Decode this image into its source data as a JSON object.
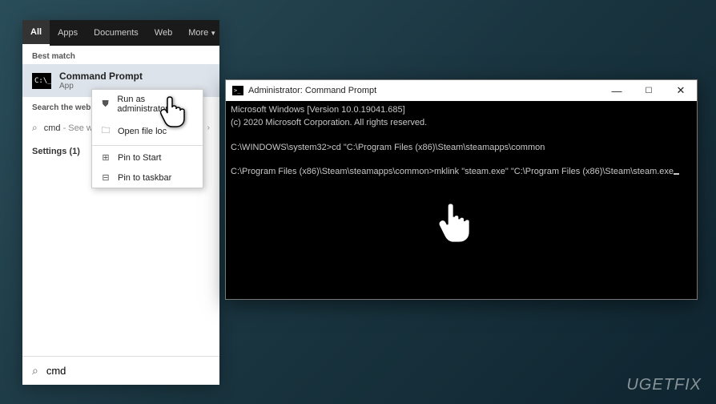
{
  "search_panel": {
    "tabs": [
      {
        "label": "All",
        "active": true
      },
      {
        "label": "Apps",
        "active": false
      },
      {
        "label": "Documents",
        "active": false
      },
      {
        "label": "Web",
        "active": false
      },
      {
        "label": "More",
        "active": false
      }
    ],
    "best_match_label": "Best match",
    "best_match": {
      "title": "Command Prompt",
      "subtitle": "App",
      "icon_text": "C:\\_"
    },
    "search_web_label": "Search the web",
    "web_item": {
      "query": "cmd",
      "suffix": " - See we"
    },
    "settings_label": "Settings (1)",
    "search_input_value": "cmd"
  },
  "context_menu": {
    "items": [
      {
        "icon": "admin-shield",
        "glyph": "⛊",
        "label": "Run as administrator"
      },
      {
        "icon": "folder",
        "glyph": "🗀",
        "label": "Open file loc"
      },
      {
        "icon": "pin-start",
        "glyph": "⊞",
        "label": "Pin to Start"
      },
      {
        "icon": "pin-taskbar",
        "glyph": "⊟",
        "label": "Pin to taskbar"
      }
    ]
  },
  "cmd_window": {
    "title": "Administrator: Command Prompt",
    "icon_text": ">_",
    "lines": {
      "l1": "Microsoft Windows [Version 10.0.19041.685]",
      "l2": "(c) 2020 Microsoft Corporation. All rights reserved.",
      "l3": "",
      "l4": "C:\\WINDOWS\\system32>cd \"C:\\Program Files (x86)\\Steam\\steamapps\\common",
      "l5": "",
      "l6": "C:\\Program Files (x86)\\Steam\\steamapps\\common>mklink \"steam.exe\" \"C:\\Program Files (x86)\\Steam\\steam.exe"
    }
  },
  "watermark": "UGETFIX"
}
